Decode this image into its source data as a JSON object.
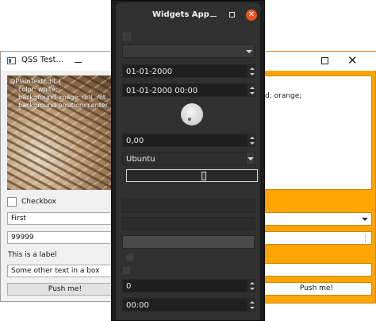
{
  "left_window": {
    "title": "QSS Test...",
    "text_edit_lines": "QPlainTextEdit {\n    color: white;\n    background-image: url(../ot\n    background-position: center",
    "checkbox_label": "Checkbox",
    "combo_value": "First",
    "spin_value": "99999",
    "label_text": "This is a label",
    "line_edit_value": "Some other text in a box",
    "button_label": "Push me!"
  },
  "right_window": {
    "text_edit_fragment": "d: orange;",
    "button_label": "Push me!",
    "background_color": "#ffa500"
  },
  "widgets_app": {
    "title": "Widgets App",
    "date_value": "01-01-2000",
    "datetime_value": "01-01-2000 00:00",
    "double_spin_value": "0,00",
    "font_combo_value": "Ubuntu",
    "spin_value": "0",
    "time_value": "00:00",
    "close_color": "#e95420"
  }
}
